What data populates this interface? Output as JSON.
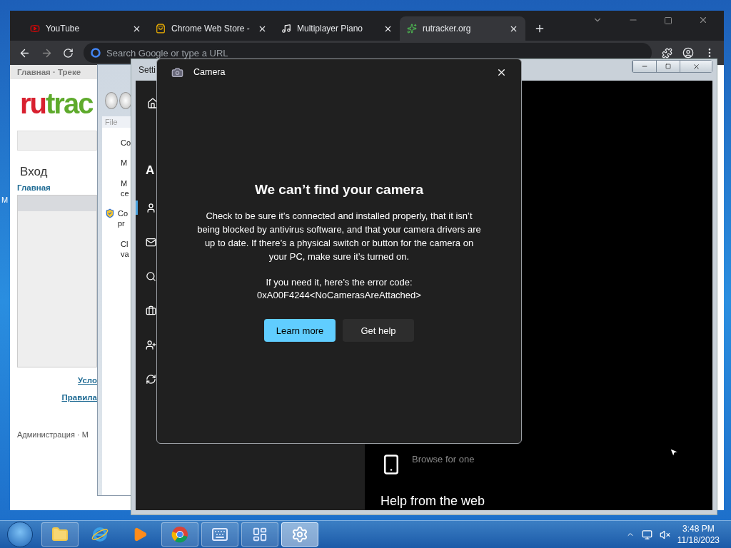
{
  "browser": {
    "tabs": [
      {
        "label": "YouTube",
        "kind": "youtube",
        "selected": false
      },
      {
        "label": "Chrome Web Store -",
        "kind": "store",
        "selected": false
      },
      {
        "label": "Multiplayer Piano",
        "kind": "piano",
        "selected": false
      },
      {
        "label": "rutracker.org",
        "kind": "tracker",
        "selected": true
      }
    ],
    "address": {
      "placeholder": "Search Google or type a URL"
    },
    "page": {
      "nav": "Главная · Треке",
      "logo_parts": [
        "ru",
        "trac"
      ],
      "heading": "Вход",
      "breadcrumb": "Главная",
      "links": [
        "Усло",
        "Правила"
      ],
      "footer": "Администрация · М"
    }
  },
  "desktop_icon_label": "M",
  "explorer": {
    "menu": "File",
    "items": [
      {
        "text": "Co",
        "kind": "plain"
      },
      {
        "text": "M",
        "kind": "plain"
      },
      {
        "text": "M\nce",
        "kind": "plain"
      },
      {
        "text": "Co\npr",
        "kind": "shield"
      },
      {
        "text": "Cl\nva",
        "kind": "plain"
      }
    ]
  },
  "settings": {
    "title": "Setti",
    "heading": "A",
    "nav": [
      {
        "kind": "user",
        "selected": true
      },
      {
        "kind": "mail",
        "selected": false
      },
      {
        "kind": "search",
        "selected": false
      },
      {
        "kind": "briefcase",
        "selected": false
      },
      {
        "kind": "adduser",
        "selected": false
      },
      {
        "kind": "sync",
        "selected": false
      }
    ],
    "browse": "Browse for one",
    "help_heading": "Help from the web"
  },
  "camera": {
    "title": "Camera",
    "heading": "We can’t find your camera",
    "body": "Check to be sure it’s connected and installed properly, that it isn’t being blocked by antivirus software, and that your camera drivers are up to date. If there’s a physical switch or button for the camera on your PC, make sure it’s turned on.",
    "error_intro": "If you need it, here’s the error code:",
    "error_code": "0xA00F4244<NoCamerasAreAttached>",
    "buttons": [
      {
        "label": "Learn more",
        "kind": "primary"
      },
      {
        "label": "Get help",
        "kind": "secondary"
      }
    ]
  },
  "taskbar": {
    "apps": [
      {
        "kind": "folder",
        "running": true,
        "selected": false
      },
      {
        "kind": "ie",
        "running": false,
        "selected": false
      },
      {
        "kind": "media",
        "running": false,
        "selected": false
      },
      {
        "kind": "chrome",
        "running": true,
        "selected": false
      },
      {
        "kind": "keyboard",
        "running": true,
        "selected": false
      },
      {
        "kind": "panel",
        "running": true,
        "selected": false
      },
      {
        "kind": "gear",
        "running": true,
        "selected": true
      }
    ],
    "time": "3:48 PM",
    "date": "11/18/2023"
  }
}
